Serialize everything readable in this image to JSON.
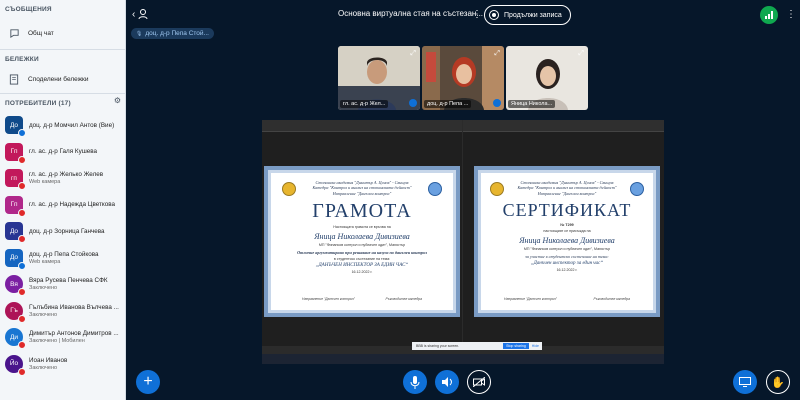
{
  "sidebar": {
    "messages_title": "СЪОБЩЕНИЯ",
    "public_chat": "Общ чат",
    "notes_title": "БЕЛЕЖКИ",
    "shared_notes": "Споделени бележки",
    "users_title": "ПОТРЕБИТЕЛИ (17)",
    "users": [
      {
        "initials": "До",
        "name": "доц. д-р Момчил Антов (Вие)",
        "sub": "",
        "color": "#0f4a8a",
        "round": false,
        "mic": "on"
      },
      {
        "initials": "Гп",
        "name": "гл. ас. д-р Галя Кушева",
        "sub": "",
        "color": "#c2185b",
        "round": false,
        "mic": "off"
      },
      {
        "initials": "гп",
        "name": "гл. ас. д-р Желько Желев",
        "sub": "Web камера",
        "color": "#c2185b",
        "round": false,
        "mic": "off"
      },
      {
        "initials": "Гп",
        "name": "гл. ас. д-р Надежда Цветкова",
        "sub": "",
        "color": "#b0288a",
        "round": false,
        "mic": "off"
      },
      {
        "initials": "До",
        "name": "доц. д-р Зорница Ганчева",
        "sub": "",
        "color": "#283593",
        "round": false,
        "mic": "off"
      },
      {
        "initials": "До",
        "name": "доц. д-р Пепа Стойкова",
        "sub": "Web камера",
        "color": "#1565c0",
        "round": false,
        "mic": "on"
      },
      {
        "initials": "Вя",
        "name": "Вяра Русева Пенчева СФК",
        "sub": "Заключено",
        "color": "#7b1fa2",
        "round": true,
        "mic": "off"
      },
      {
        "initials": "Гъ",
        "name": "Гълъбина Иванова Вълчева ...",
        "sub": "Заключено",
        "color": "#ad1457",
        "round": true,
        "mic": "off"
      },
      {
        "initials": "Ди",
        "name": "Димитър Антонов Димитров ...",
        "sub": "Заключено | Мобилен",
        "color": "#1976d2",
        "round": true,
        "mic": "off"
      },
      {
        "initials": "Йо",
        "name": "Йоан Иванов",
        "sub": "Заключено",
        "color": "#4a148c",
        "round": true,
        "mic": "off"
      }
    ]
  },
  "topbar": {
    "room_title": "Основна виртуална стая на състезан...",
    "record_label": "Продължи записа",
    "presenter": "доц. д-р Пепа Стой..."
  },
  "videos": [
    {
      "label": "гл. ас. д-р Жел..."
    },
    {
      "label": "доц. д-р Пепа ..."
    },
    {
      "label": "Яница Никола..."
    }
  ],
  "share": {
    "cert1": {
      "header": "Стопанска академия \"Димитър А. Ценов\" - Свищов",
      "header2": "Катедра \"Контрол и анализ на стопанската дейност\"",
      "header3": "Направление \"Данъчен контрол\"",
      "title": "ГРАМОТА",
      "given": "Настоящата грамота се връчва на",
      "name": "Яница Николаева Дивизиева",
      "sub": "МП \"Финансов контрол и публичен одит\", Магистър",
      "text1": "Отличие аргументирано при решаване на казуса по данъчен контрол",
      "text2": "в студентско състезание на тема:",
      "event": "„ДАНЪЧЕН ИНСПЕКТОР ЗА ЕДИН ЧАС“",
      "date": "16.12.2022 г.",
      "sign_left": "Направление \"Данъчен контрол\"",
      "sign_right": "Ръководител катедра"
    },
    "cert2": {
      "header": "Стопанска академия \"Димитър А. Ценов\" - Свищов",
      "header2": "Катедра \"Контрол и анализ на стопанската дейност\"",
      "header3": "Направление \"Данъчен контрол\"",
      "title": "СЕРТИФИКАТ",
      "number": "№ Т299",
      "given": "настоящият се присъжда на",
      "name": "Яница Николаева Дивизиева",
      "sub": "МП \"Финансов контрол и публичен одит\", Магистър",
      "text1": "за участие в студентско състезание на тема:",
      "event": "„Данъчен инспектор за един час“",
      "date": "16.12.2022 г.",
      "sign_left": "Направление \"Данъчен контрол\"",
      "sign_right": "Ръководител катедра"
    },
    "dialog_text": "BBB is sharing your screen.",
    "dialog_stop": "Stop sharing",
    "dialog_hide": "Hide"
  },
  "colors": {
    "background": "#06172a",
    "accent": "#0f70d7",
    "sidebar": "#f3f6f9"
  }
}
